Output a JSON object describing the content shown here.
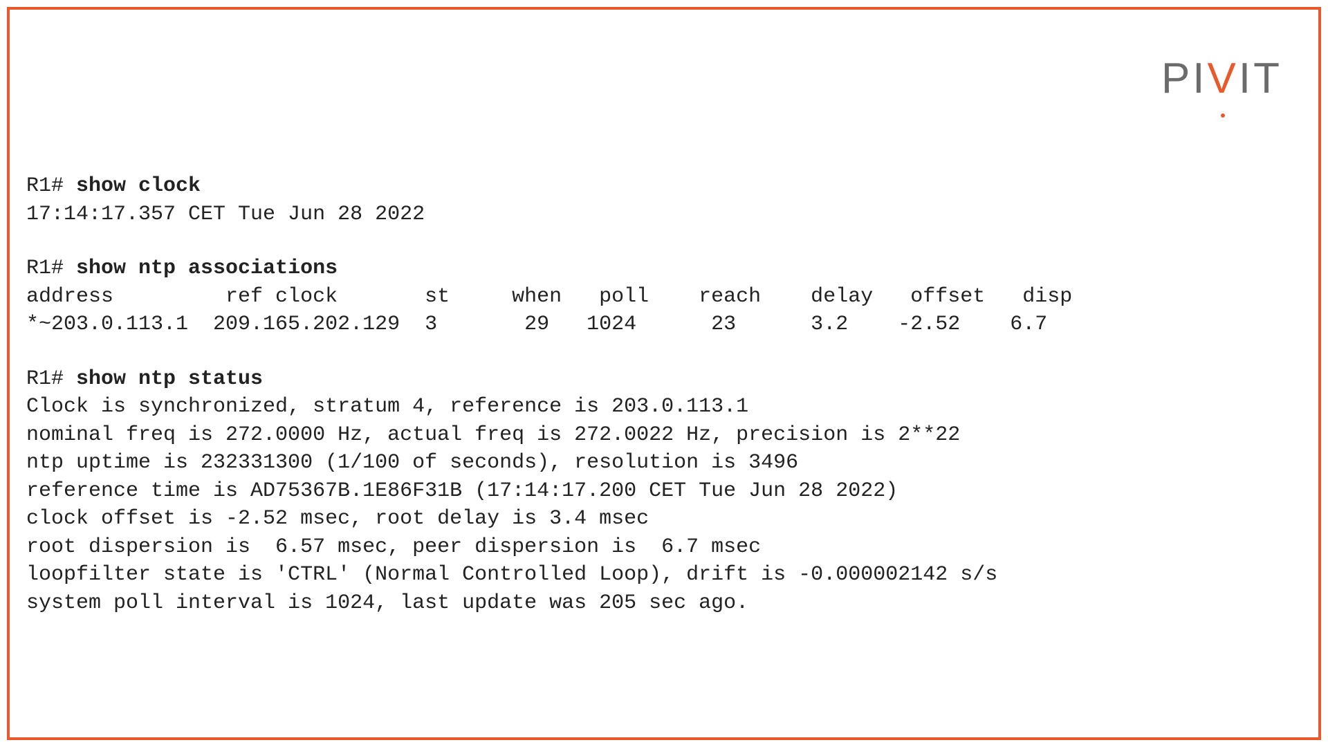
{
  "logo": {
    "p1": "PI",
    "v": "V",
    "p2": "IT"
  },
  "prompts": {
    "prefix": "R1# ",
    "show_clock": "show clock",
    "show_ntp_assoc": "show ntp associations",
    "show_ntp_status": "show ntp status"
  },
  "clock": {
    "value": "17:14:17.357 CET Tue Jun 28 2022"
  },
  "assoc": {
    "header": "address         ref clock       st     when   poll    reach    delay   offset   disp",
    "row1": "*~203.0.113.1  209.165.202.129  3       29   1024      23      3.2    -2.52    6.7"
  },
  "status": {
    "l1": "Clock is synchronized, stratum 4, reference is 203.0.113.1",
    "l2": "nominal freq is 272.0000 Hz, actual freq is 272.0022 Hz, precision is 2**22",
    "l3": "ntp uptime is 232331300 (1/100 of seconds), resolution is 3496",
    "l4": "reference time is AD75367B.1E86F31B (17:14:17.200 CET Tue Jun 28 2022)",
    "l5": "clock offset is -2.52 msec, root delay is 3.4 msec",
    "l6": "root dispersion is  6.57 msec, peer dispersion is  6.7 msec",
    "l7": "loopfilter state is 'CTRL' (Normal Controlled Loop), drift is -0.000002142 s/s",
    "l8": "system poll interval is 1024, last update was 205 sec ago."
  }
}
